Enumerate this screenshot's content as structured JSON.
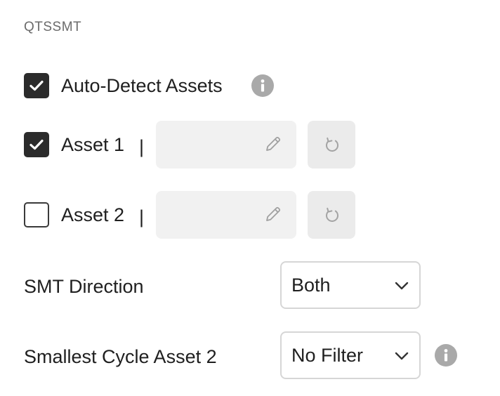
{
  "section_title": "QTSSMT",
  "auto_detect": {
    "label": "Auto-Detect Assets",
    "checked": true,
    "icon": "info-icon"
  },
  "asset1": {
    "label": "Asset 1",
    "separator": "|",
    "checked": true,
    "value": "",
    "edit_icon": "pencil-icon",
    "reset_icon": "reset-icon"
  },
  "asset2": {
    "label": "Asset 2",
    "separator": "|",
    "checked": false,
    "value": "",
    "edit_icon": "pencil-icon",
    "reset_icon": "reset-icon"
  },
  "smt_direction": {
    "label": "SMT Direction",
    "selected": "Both"
  },
  "smallest_cycle": {
    "label": "Smallest Cycle Asset 2",
    "selected": "No Filter",
    "icon": "info-icon"
  },
  "colors": {
    "checkbox_fill": "#2b2b2b",
    "field_bg": "#f1f1f1",
    "info_icon": "#a9a9a9",
    "select_border": "#d6d6d6"
  }
}
